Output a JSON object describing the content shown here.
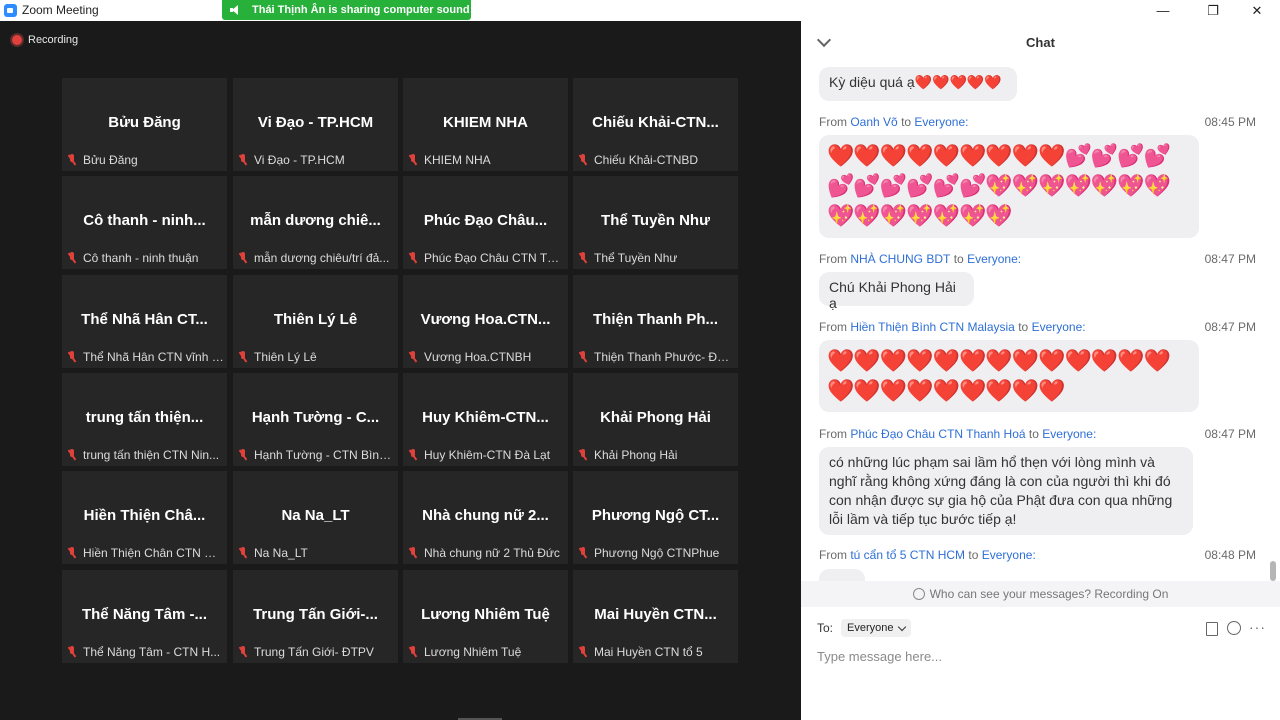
{
  "window": {
    "title": "Zoom Meeting",
    "minimize_glyph": "—",
    "maximize_glyph": "❐",
    "close_glyph": "✕"
  },
  "banner": {
    "text": "Thái Thịnh Ân is sharing computer sound"
  },
  "recording": {
    "label": "Recording"
  },
  "participants": [
    {
      "name": "Bửu Đăng",
      "label": "Bửu Đăng"
    },
    {
      "name": "Vi Đạo - TP.HCM",
      "label": "Vi Đạo - TP.HCM"
    },
    {
      "name": "KHIEM NHA",
      "label": "KHIEM NHA"
    },
    {
      "name": "Chiếu  Khải-CTN...",
      "label": "Chiếu Khải-CTNBD"
    },
    {
      "name": "Cô thanh - ninh...",
      "label": "Cô thanh - ninh thuận"
    },
    {
      "name": "mẫn dương chiê...",
      "label": "mẫn dương chiêu/trí đả..."
    },
    {
      "name": "Phúc Đạo Châu...",
      "label": "Phúc Đạo Châu CTN Tha..."
    },
    {
      "name": "Thể Tuyền Như",
      "label": "Thể Tuyền Như"
    },
    {
      "name": "Thể Nhã Hân CT...",
      "label": "Thể Nhã Hân CTN vĩnh l..."
    },
    {
      "name": "Thiên Lý Lê",
      "label": "Thiên Lý Lê"
    },
    {
      "name": "Vương  Hoa.CTN...",
      "label": "Vương Hoa.CTNBH"
    },
    {
      "name": "Thiện Thanh Ph...",
      "label": "Thiện Thanh Phước- ĐT ..."
    },
    {
      "name": "trung tấn thiện...",
      "label": "trung tấn thiện CTN Nin..."
    },
    {
      "name": "Hạnh Tường - C...",
      "label": "Hạnh Tường - CTN Bình ..."
    },
    {
      "name": "Huy  Khiêm-CTN...",
      "label": "Huy Khiêm-CTN Đà Lạt"
    },
    {
      "name": "Khải Phong Hải",
      "label": "Khải Phong Hải"
    },
    {
      "name": "Hiền Thiện Châ...",
      "label": "Hiền Thiện Chân CTN M..."
    },
    {
      "name": "Na Na_LT",
      "label": "Na Na_LT"
    },
    {
      "name": "Nhà chung nữ 2...",
      "label": "Nhà chung nữ 2 Thủ Đức"
    },
    {
      "name": "Phương Ngộ CT...",
      "label": "Phương Ngộ CTNPhue"
    },
    {
      "name": "Thể Năng Tâm -...",
      "label": "Thể Năng Tâm - CTN H..."
    },
    {
      "name": "Trung Tấn Giới-...",
      "label": "Trung Tấn Giới- ĐTPV"
    },
    {
      "name": "Lương Nhiêm Tuệ",
      "label": "Lương Nhiêm Tuệ"
    },
    {
      "name": "Mai Huyền CTN...",
      "label": "Mai Huyền CTN tổ 5"
    }
  ],
  "chat": {
    "title": "Chat",
    "messages": [
      {
        "from": "",
        "to": "",
        "time": "",
        "text": "Kỳ diệu quá ạ❤️❤️❤️❤️❤️"
      },
      {
        "from": "Oanh Võ",
        "to": "Everyone:",
        "time": "08:45 PM",
        "text": "❤️❤️❤️❤️❤️❤️❤️❤️❤️💕💕💕💕💕💕💕💕💕💕💖💖💖💖💖💖💖💖💖💖💖💖💖💖"
      },
      {
        "from": "NHÀ CHUNG BDT",
        "to": "Everyone:",
        "time": "08:47 PM",
        "text": "Chú Khải Phong Hải ạ"
      },
      {
        "from": "Hiền Thiện Bình  CTN Malaysia",
        "to": "Everyone:",
        "time": "08:47 PM",
        "text": "❤️❤️❤️❤️❤️❤️❤️❤️❤️❤️❤️❤️❤️❤️❤️❤️❤️❤️❤️❤️❤️❤️"
      },
      {
        "from": "Phúc Đạo Châu CTN Thanh Hoá",
        "to": "Everyone:",
        "time": "08:47 PM",
        "text": "có những lúc phạm sai lầm hổ thẹn với lòng mình và nghĩ rằng  không xứng đáng là con của người thì khi đó con nhận được sự gia hộ của Phật đưa con qua những lỗi lầm và tiếp tục bước tiếp ạ!"
      },
      {
        "from": "tú cẩn tổ 5 CTN HCM",
        "to": "Everyone:",
        "time": "08:48 PM",
        "text": ""
      }
    ],
    "from_word": "From",
    "to_word": "to",
    "privacy_note": "Who can see your messages? Recording On",
    "to_label": "To:",
    "recipient": "Everyone",
    "input_placeholder": "Type message here...",
    "more_glyph": "···"
  },
  "colors": {
    "banner": "#27b03a",
    "mic_muted": "#e0413a",
    "sender_link": "#2e6fd6",
    "tile_bg": "#262626"
  },
  "icons": [
    "zoom-icon",
    "speaker-icon",
    "recording-dot-icon",
    "mic-muted-icon",
    "chevron-down-icon",
    "info-icon",
    "file-icon",
    "emoji-icon",
    "more-icon"
  ]
}
